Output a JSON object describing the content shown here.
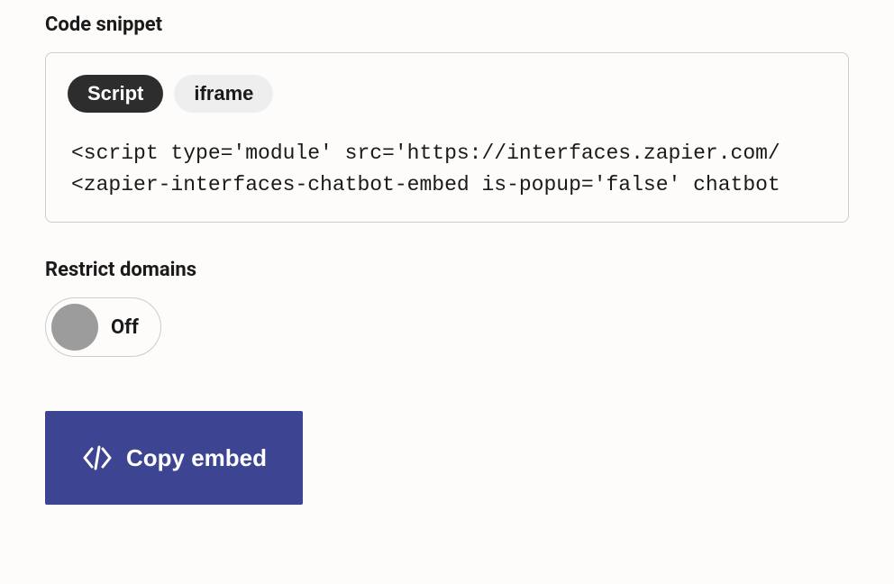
{
  "code_snippet": {
    "label": "Code snippet",
    "tabs": [
      {
        "label": "Script",
        "active": true
      },
      {
        "label": "iframe",
        "active": false
      }
    ],
    "code_line1": "<script type='module' src='https://interfaces.zapier.com/",
    "code_line2": "<zapier-interfaces-chatbot-embed is-popup='false' chatbot"
  },
  "restrict_domains": {
    "label": "Restrict domains",
    "state_label": "Off"
  },
  "copy_button": {
    "label": "Copy embed"
  }
}
